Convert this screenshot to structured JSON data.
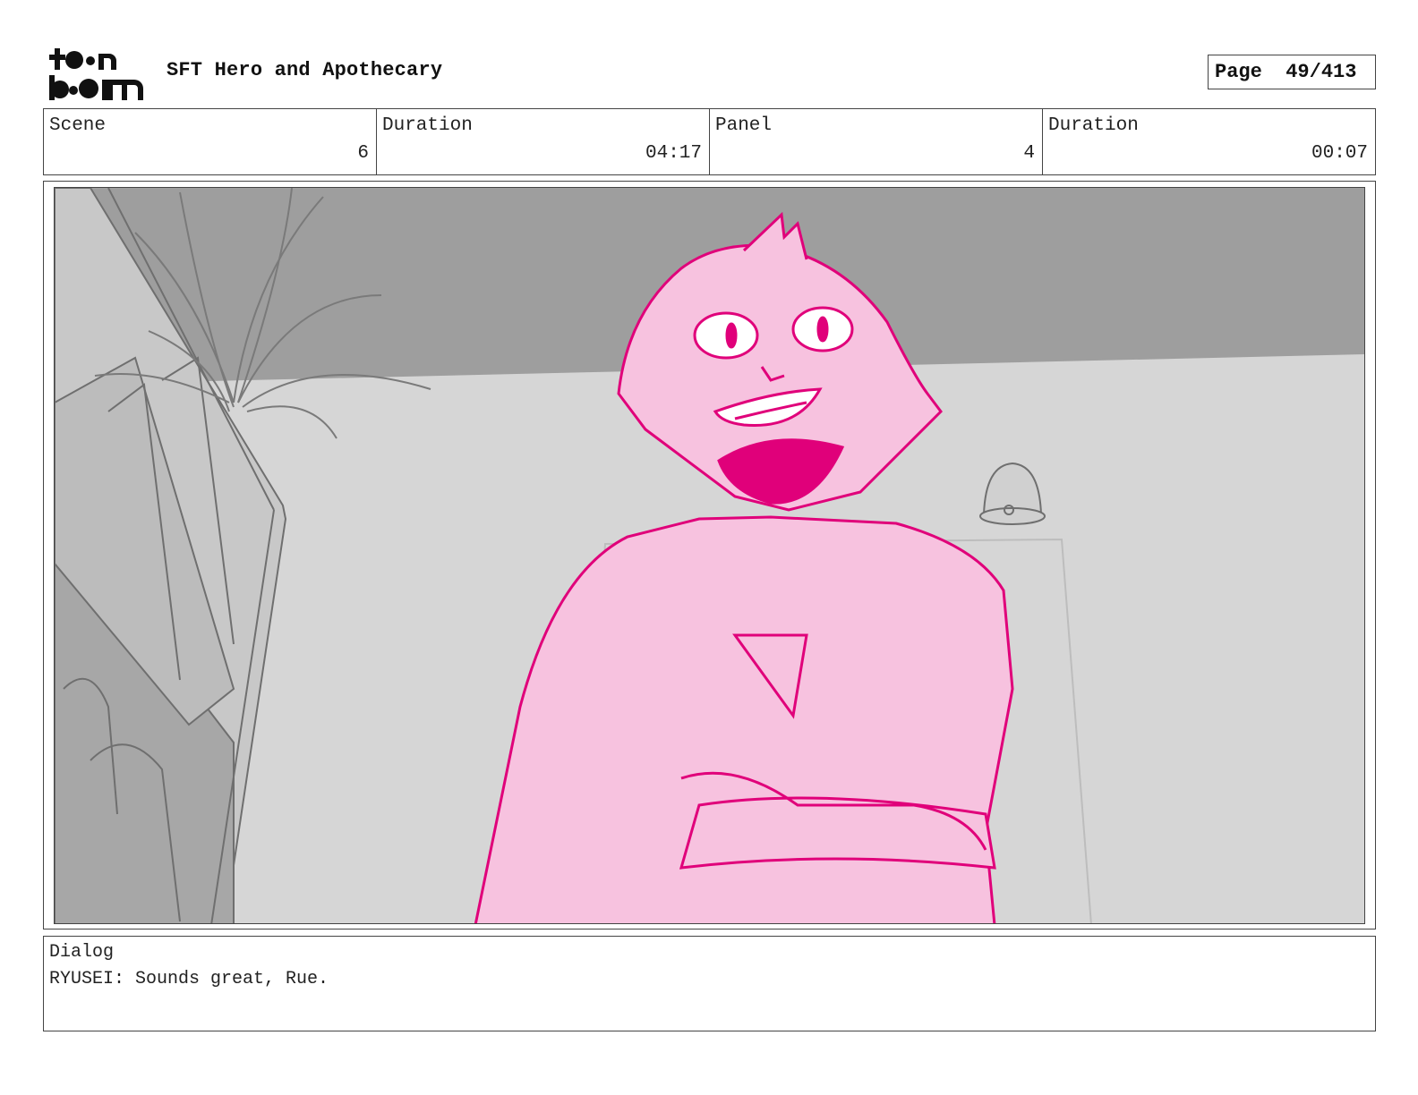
{
  "header": {
    "logo_text": "toon boom",
    "project_title": "SFT Hero and Apothecary",
    "page_label": "Page",
    "page_value": "49/413"
  },
  "info": {
    "scene_label": "Scene",
    "scene_value": "6",
    "scene_duration_label": "Duration",
    "scene_duration_value": "04:17",
    "panel_label": "Panel",
    "panel_value": "4",
    "panel_duration_label": "Duration",
    "panel_duration_value": "00:07"
  },
  "panel": {
    "description": "",
    "colors": {
      "background_wall": "#d6d6d6",
      "ceiling": "#9e9e9e",
      "sketch_lines": "#6f6f6f",
      "character_fill": "#f7c2df",
      "character_lines": "#e0007a"
    }
  },
  "dialog": {
    "label": "Dialog",
    "text": "RYUSEI: Sounds great, Rue."
  }
}
